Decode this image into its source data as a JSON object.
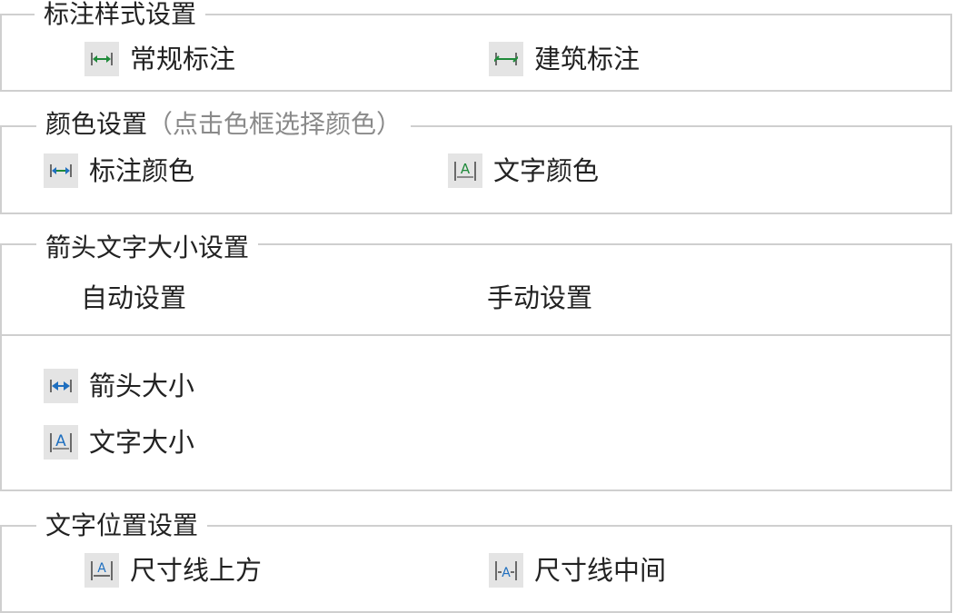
{
  "dimension_style": {
    "title": "标注样式设置",
    "options": [
      {
        "label": "常规标注",
        "icon": "regular-dimension-icon"
      },
      {
        "label": "建筑标注",
        "icon": "architectural-dimension-icon"
      }
    ]
  },
  "color": {
    "title": "颜色设置",
    "hint": "（点击色框选择颜色）",
    "options": [
      {
        "label": "标注颜色",
        "icon": "dimension-color-icon"
      },
      {
        "label": "文字颜色",
        "icon": "text-color-icon"
      }
    ]
  },
  "size": {
    "title": "箭头文字大小设置",
    "modes": [
      "自动设置",
      "手动设置"
    ],
    "options": [
      {
        "label": "箭头大小",
        "icon": "arrow-size-icon"
      },
      {
        "label": "文字大小",
        "icon": "text-size-icon"
      }
    ]
  },
  "text_position": {
    "title": "文字位置设置",
    "options": [
      {
        "label": "尺寸线上方",
        "icon": "text-above-line-icon"
      },
      {
        "label": "尺寸线中间",
        "icon": "text-middle-line-icon"
      }
    ]
  },
  "colors": {
    "border": "#cfcfcf",
    "icon_bg": "#e4e4e4",
    "green": "#1f8a3a",
    "blue": "#1f6fbf",
    "hint_gray": "#8a8a8a"
  }
}
